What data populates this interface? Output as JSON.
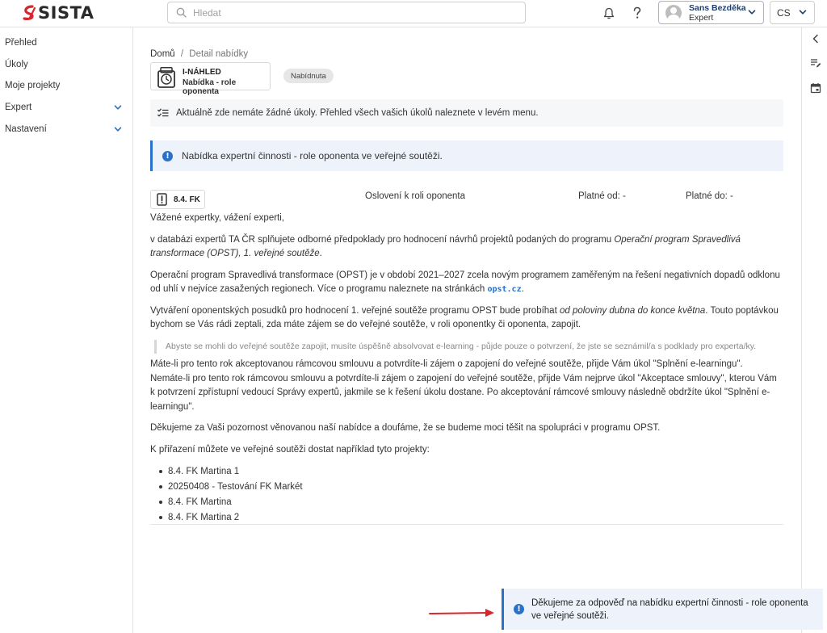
{
  "header": {
    "logo_text": "SISTA",
    "search_placeholder": "Hledat",
    "user_name": "Sans Bezděka",
    "user_role": "Expert",
    "language": "CS"
  },
  "sidebar": {
    "items": [
      {
        "label": "Přehled"
      },
      {
        "label": "Úkoly"
      },
      {
        "label": "Moje projekty"
      },
      {
        "label": "Expert"
      },
      {
        "label": "Nastavení"
      }
    ]
  },
  "breadcrumb": {
    "home": "Domů",
    "separator": "/",
    "current": "Detail nabídky"
  },
  "offer": {
    "title": "I-NÁHLED",
    "subtitle": "Nabídka - role oponenta",
    "status": "Nabídnuta"
  },
  "tasks_notice": "Aktuálně zde nemáte žádné úkoly. Přehled všech vašich úkolů naleznete v levém menu.",
  "info_notice": "Nabídka expertní činnosti - role oponenta ve veřejné soutěži.",
  "document": {
    "code": "8.4. FK",
    "label": "Oslovení k roli oponenta",
    "valid_from": "Platné od: -",
    "valid_to": "Platné do: -"
  },
  "letter": {
    "greeting": "Vážené expertky, vážení experti,",
    "p1_start": "v databázi expertů TA ČR splňujete odborné předpoklady pro hodnocení návrhů projektů podaných do programu ",
    "p1_italic": "Operační program Spravedlivá transformace (OPST), 1. veřejné soutěže",
    "p1_end": ".",
    "p2_start": "Operační program Spravedlivá transformace (OPST) je v období 2021–2027 zcela novým programem zaměřeným na řešení negativních dopadů odklonu od uhlí v nejvíce zasažených regionech. Více o programu naleznete na stránkách ",
    "p2_link": "opst.cz",
    "p2_end": ".",
    "p3_start": "Vytváření oponentských posudků pro hodnocení 1. veřejné soutěže programu OPST bude probíhat ",
    "p3_italic": "od poloviny dubna do konce května",
    "p3_end": ". Touto poptávkou bychom se Vás rádi zeptali, zda máte zájem se do veřejné soutěže, v roli oponentky či oponenta, zapojit.",
    "quote": "Abyste se mohli do veřejné soutěže zapojit, musíte úspěšně absolvovat e-learning - půjde pouze o potvrzení, že jste se seznámil/a s podklady pro experta/ky.",
    "p4_line1": "Máte-li pro tento rok akceptovanou rámcovou smlouvu a potvrdíte-li zájem o zapojení do veřejné soutěže, přijde Vám úkol \"Splnění e-learningu\".",
    "p4_line2": "Nemáte-li pro tento rok rámcovou smlouvu a potvrdíte-li zájem o zapojení do veřejné soutěže, přijde Vám nejprve úkol \"Akceptace smlouvy\", kterou Vám k potvrzení zpřístupní vedoucí Správy expertů, jakmile se k řešení úkolu dostane. Po akceptování rámcové smlouvy následně obdržíte úkol \"Splnění e-learningu\".",
    "p5": "Děkujeme za Vaši pozornost věnovanou naší nabídce a doufáme, že se budeme moci těšit na spolupráci v programu OPST.",
    "p6": "K přiřazení můžete ve veřejné soutěži dostat například tyto projekty:",
    "projects": [
      "8.4. FK Martina 1",
      "20250408 - Testování FK Markét",
      "8.4. FK Martina",
      "8.4. FK Martina 2"
    ]
  },
  "toast": "Děkujeme za odpověď na nabídku expertní činnosti - role oponenta ve veřejné soutěži.",
  "colors": {
    "accent": "#2a72c9",
    "logo_red": "#d9252b",
    "arrow": "#d9252b"
  }
}
